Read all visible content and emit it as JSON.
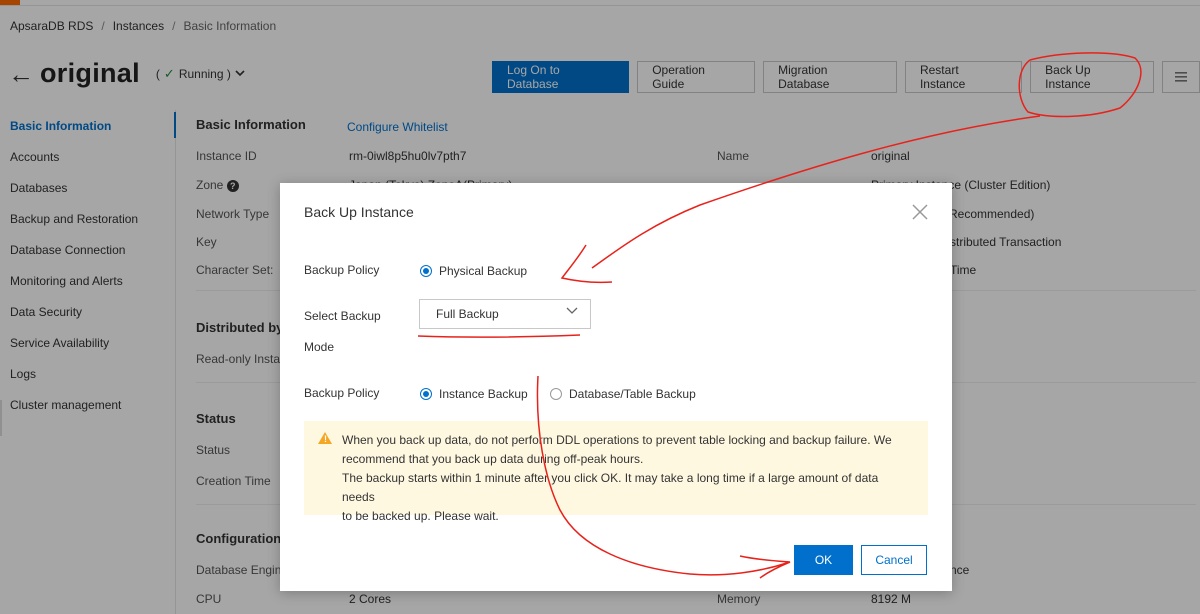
{
  "breadcrumb": [
    "ApsaraDB RDS",
    "Instances",
    "Basic Information"
  ],
  "breadcrumb_sep": "/",
  "header": {
    "title": "original",
    "status": "Running )",
    "status_open": "("
  },
  "actions": {
    "log_on": "Log On to Database",
    "operation_guide": "Operation Guide",
    "migration": "Migration Database",
    "restart": "Restart Instance",
    "backup": "Back Up Instance"
  },
  "sidebar": {
    "items": [
      {
        "label": "Basic Information"
      },
      {
        "label": "Accounts"
      },
      {
        "label": "Databases"
      },
      {
        "label": "Backup and Restoration"
      },
      {
        "label": "Database Connection"
      },
      {
        "label": "Monitoring and Alerts"
      },
      {
        "label": "Data Security"
      },
      {
        "label": "Service Availability"
      },
      {
        "label": "Logs"
      },
      {
        "label": "Cluster management"
      }
    ]
  },
  "basic": {
    "title": "Basic Information",
    "whitelist_link": "Configure Whitelist",
    "instance_id_label": "Instance ID",
    "instance_id": "rm-0iwl8p5hu0lv7pth7",
    "name_label": "Name",
    "name": "original",
    "zone_label": "Zone",
    "zone_value": "Japan (Tokyo) ZoneA(Primary)",
    "role_value": "Primary Instance (Cluster Edition)",
    "network_label": "Network Type",
    "recommended": "Recommended)",
    "key_label": "Key",
    "distributed_tx": "stributed Transaction",
    "charset_label": "Character Set:",
    "time": "Time"
  },
  "distributed": {
    "title": "Distributed by",
    "readonly": "Read-only Instan"
  },
  "status_section": {
    "title": "Status",
    "status_label": "Status",
    "creation_label": "Creation Time"
  },
  "config": {
    "title": "Configuration",
    "engine_label": "Database Engine",
    "cpu_label": "CPU",
    "cpu_value": "2 Cores",
    "memory_label": "Memory",
    "memory_value": "8192 M",
    "nce": "nce"
  },
  "dialog": {
    "title": "Back Up Instance",
    "policy_label": "Backup Policy",
    "physical_backup": "Physical Backup",
    "mode_label_1": "Select Backup",
    "mode_label_2": "Mode",
    "mode_value": "Full Backup",
    "policy2_label": "Backup Policy",
    "instance_backup": "Instance Backup",
    "table_backup": "Database/Table Backup",
    "notice_line1": "When you back up data, do not perform DDL operations to prevent table locking and backup failure. We",
    "notice_line2": "recommend that you back up data during off-peak hours.",
    "notice_line3": "The backup starts within 1 minute after you click OK. It may take a long time if a large amount of data needs",
    "notice_line4": "to be backed up. Please wait.",
    "ok": "OK",
    "cancel": "Cancel"
  },
  "colors": {
    "accent": "#0070cc",
    "brand": "#ff6a00",
    "annotation": "#e8221b",
    "notice_bg": "#fff8e1"
  }
}
